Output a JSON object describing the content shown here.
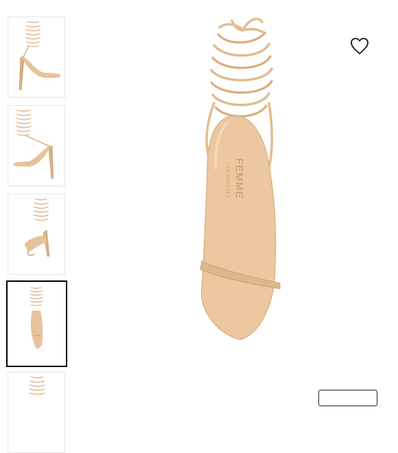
{
  "product": {
    "brand_mark": "FEMME",
    "brand_sub": "LOS ANGELES"
  },
  "gallery": {
    "selected_index": 3,
    "thumbnails": [
      {
        "view": "side-right"
      },
      {
        "view": "side-left"
      },
      {
        "view": "back"
      },
      {
        "view": "top-down"
      },
      {
        "view": "detail"
      }
    ]
  },
  "icons": {
    "wishlist": "heart-outline-icon"
  },
  "colors": {
    "shoe": "#e8c29a",
    "shoe_dark": "#c99e73",
    "selected_border": "#000000"
  }
}
